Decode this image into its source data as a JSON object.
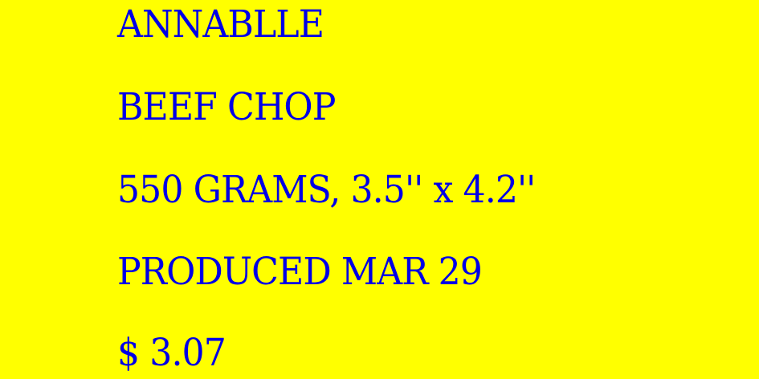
{
  "label": {
    "brand": "ANNABLLE",
    "product": "BEEF CHOP",
    "weight_size": "550 GRAMS, 3.5'' x 4.2''",
    "produced": "PRODUCED MAR 29",
    "price": "$ 3.07"
  },
  "colors": {
    "background": "#ffff00",
    "text": "#0000e6"
  }
}
